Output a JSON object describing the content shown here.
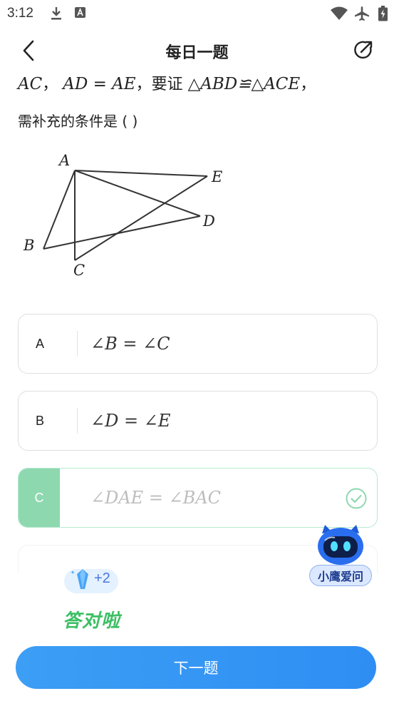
{
  "status": {
    "time": "3:12",
    "icons": [
      "download-icon",
      "a-icon",
      "wifi-icon",
      "airplane-icon",
      "battery-icon"
    ]
  },
  "nav": {
    "title": "每日一题"
  },
  "question": {
    "line1_part1": "AC",
    "sep1": "，",
    "line1_part2": "AD = AE",
    "sep2": "，要证",
    "line1_part3": "△ABD≌△ACE",
    "sep3": "，",
    "line2": "需补充的条件是 (    )"
  },
  "figure": {
    "labels": {
      "A": "A",
      "B": "B",
      "C": "C",
      "D": "D",
      "E": "E"
    }
  },
  "options": [
    {
      "letter": "A",
      "text": "∠B = ∠C"
    },
    {
      "letter": "B",
      "text": "∠D = ∠E"
    },
    {
      "letter": "C",
      "text": "∠DAE = ∠BAC"
    }
  ],
  "assistant": {
    "label": "小鹰爱问"
  },
  "reward": {
    "count": "+2",
    "text": "答对啦"
  },
  "next_button": {
    "label": "下一题"
  },
  "colors": {
    "accent": "#2f8ef3",
    "correct": "#8ed8b0",
    "reward_green": "#3cbf63"
  }
}
